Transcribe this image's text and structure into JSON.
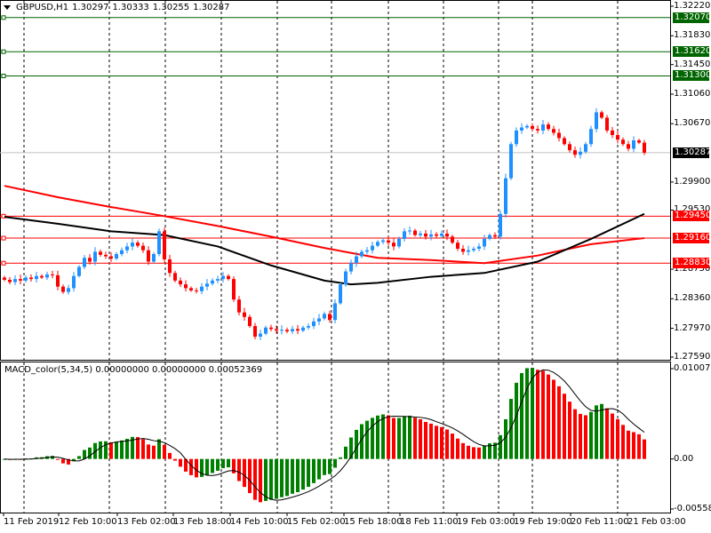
{
  "header": {
    "symbol": "GBPUSD,H1",
    "open": "1.30297",
    "high": "1.30333",
    "low": "1.30255",
    "close": "1.30287"
  },
  "macd_header": "MACD_color(5,34,5) 0.00000000 0.00000000 0.00052369",
  "colors": {
    "up": "#1E90FF",
    "down": "#FF0000",
    "support": "#FF0000",
    "resistance": "#006400",
    "ma_slow": "#FF0000",
    "ma_fast": "#000000",
    "hist_up": "#008000",
    "hist_down": "#FF0000"
  },
  "chart_data": {
    "type": "candlestick",
    "title": "GBPUSD,H1",
    "ylim": [
      1.2759,
      1.3222
    ],
    "price_ticks": [
      "1.32220",
      "1.31830",
      "1.31450",
      "1.31060",
      "1.30670",
      "1.29900",
      "1.29530",
      "1.28750",
      "1.28360",
      "1.27970",
      "1.27590"
    ],
    "tick_values": [
      1.3222,
      1.3183,
      1.3145,
      1.3106,
      1.3067,
      1.299,
      1.2953,
      1.2875,
      1.2836,
      1.2797,
      1.2759
    ],
    "time_labels": [
      "11 Feb 2019",
      "12 Feb 10:00",
      "13 Feb 02:00",
      "13 Feb 18:00",
      "14 Feb 10:00",
      "15 Feb 02:00",
      "15 Feb 18:00",
      "18 Feb 11:00",
      "19 Feb 03:00",
      "19 Feb 19:00",
      "20 Feb 11:00",
      "21 Feb 03:00"
    ],
    "closes": [
      1.2861,
      1.2858,
      1.2862,
      1.286,
      1.2864,
      1.2862,
      1.2866,
      1.2864,
      1.2868,
      1.2867,
      1.2852,
      1.2845,
      1.285,
      1.2866,
      1.2878,
      1.289,
      1.2885,
      1.2898,
      1.2894,
      1.2892,
      1.2889,
      1.2895,
      1.29,
      1.2905,
      1.291,
      1.2906,
      1.29,
      1.2885,
      1.2895,
      1.2925,
      1.2888,
      1.287,
      1.286,
      1.2855,
      1.285,
      1.2847,
      1.2846,
      1.2852,
      1.2856,
      1.286,
      1.2862,
      1.2866,
      1.2862,
      1.2835,
      1.2818,
      1.2812,
      1.28,
      1.2786,
      1.279,
      1.2798,
      1.2796,
      1.2794,
      1.2795,
      1.2793,
      1.2796,
      1.2794,
      1.2798,
      1.28,
      1.2806,
      1.281,
      1.2816,
      1.2808,
      1.283,
      1.2855,
      1.2872,
      1.2883,
      1.2892,
      1.2898,
      1.29,
      1.2906,
      1.2911,
      1.2913,
      1.291,
      1.2905,
      1.2915,
      1.2925,
      1.2926,
      1.292,
      1.2922,
      1.2918,
      1.2921,
      1.2919,
      1.2922,
      1.2918,
      1.291,
      1.2902,
      1.2898,
      1.29,
      1.2902,
      1.2905,
      1.2915,
      1.292,
      1.2918,
      1.2948,
      1.2995,
      1.304,
      1.3058,
      1.3062,
      1.3064,
      1.306,
      1.3058,
      1.3066,
      1.306,
      1.3055,
      1.3048,
      1.304,
      1.3032,
      1.3026,
      1.303,
      1.304,
      1.306,
      1.3082,
      1.3075,
      1.3058,
      1.3052,
      1.3046,
      1.304,
      1.3034,
      1.3045,
      1.3042,
      1.30287
    ],
    "ma_slow": [
      [
        0,
        1.2985
      ],
      [
        10,
        1.297
      ],
      [
        20,
        1.2957
      ],
      [
        30,
        1.2945
      ],
      [
        40,
        1.2932
      ],
      [
        50,
        1.2918
      ],
      [
        60,
        1.2903
      ],
      [
        70,
        1.289
      ],
      [
        80,
        1.2887
      ],
      [
        90,
        1.2883
      ],
      [
        100,
        1.2893
      ],
      [
        110,
        1.2908
      ],
      [
        120,
        1.2916
      ]
    ],
    "ma_fast": [
      [
        0,
        1.2944
      ],
      [
        10,
        1.2935
      ],
      [
        20,
        1.2925
      ],
      [
        30,
        1.292
      ],
      [
        40,
        1.2905
      ],
      [
        50,
        1.288
      ],
      [
        60,
        1.286
      ],
      [
        65,
        1.2855
      ],
      [
        70,
        1.2857
      ],
      [
        80,
        1.2865
      ],
      [
        90,
        1.287
      ],
      [
        100,
        1.2885
      ],
      [
        110,
        1.2915
      ],
      [
        120,
        1.2948
      ]
    ],
    "levels": [
      {
        "price": 1.3207,
        "label": "1.32070",
        "kind": "resistance"
      },
      {
        "price": 1.3162,
        "label": "1.31620",
        "kind": "resistance"
      },
      {
        "price": 1.313,
        "label": "1.31300",
        "kind": "resistance"
      },
      {
        "price": 1.2945,
        "label": "1.29450",
        "kind": "support"
      },
      {
        "price": 1.2916,
        "label": "1.29160",
        "kind": "support"
      },
      {
        "price": 1.2883,
        "label": "1.28830",
        "kind": "support"
      }
    ],
    "current_price": {
      "price": 1.30287,
      "label": "1.30287"
    },
    "macd": {
      "fast": 5,
      "slow": 34,
      "signal": 5,
      "ylim": [
        -0.005585,
        0.0100772
      ],
      "ticks": [
        "0.0100772",
        "0.00",
        "-0.005585"
      ],
      "tick_values": [
        0.0100772,
        0,
        -0.005585
      ]
    }
  }
}
